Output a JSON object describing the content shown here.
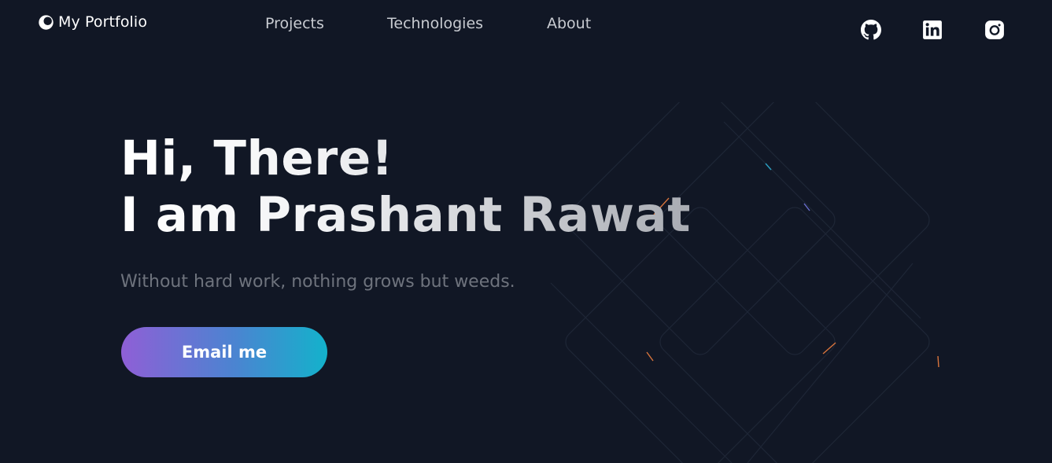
{
  "brand": {
    "name": "My Portfolio",
    "icon": "logo-icon"
  },
  "nav": {
    "items": [
      {
        "label": "Projects"
      },
      {
        "label": "Technologies"
      },
      {
        "label": "About"
      }
    ]
  },
  "social": [
    {
      "icon": "github-icon"
    },
    {
      "icon": "linkedin-icon"
    },
    {
      "icon": "instagram-icon"
    }
  ],
  "hero": {
    "line1": "Hi, There!",
    "line2": "I am Prashant Rawat",
    "tagline": "Without hard work, nothing grows but weeds.",
    "cta_label": "Email me"
  },
  "colors": {
    "background": "#111725",
    "nav_text": "#c8cbd1",
    "tagline": "#6e737d",
    "cta_gradient_start": "#8f5fd6",
    "cta_gradient_end": "#13b2cb"
  }
}
